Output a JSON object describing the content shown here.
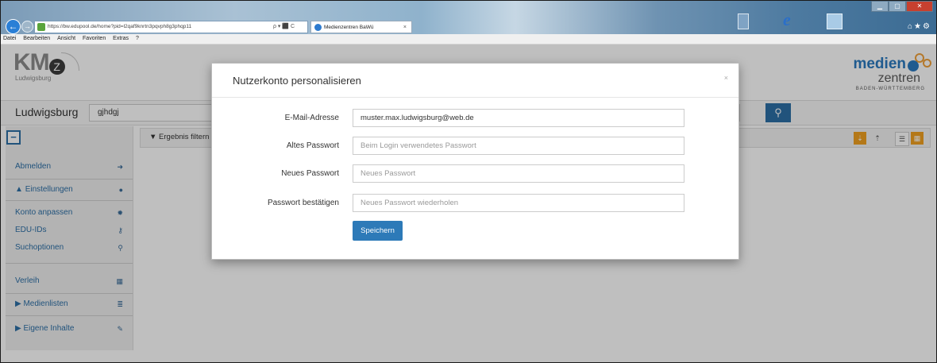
{
  "browser": {
    "url": "https://bw.edupool.de/home?pid=l2qaf9knrtn3pqvph8g3phqp11",
    "address_controls": "ρ ▾ ⬛ C",
    "tab_title": "Medienzentren BaWü",
    "tab_close": "×",
    "menu": [
      "Datei",
      "Bearbeiten",
      "Ansicht",
      "Favoriten",
      "Extras",
      "?"
    ]
  },
  "header": {
    "left_logo": {
      "mark": "KM",
      "z": "Z",
      "city": "Ludwigsburg"
    },
    "right_logo": {
      "word1": "medien",
      "word2": "zentren",
      "word3": "BADEN-WÜRTTEMBERG"
    }
  },
  "search": {
    "city": "Ludwigsburg",
    "query": "gjhdgj",
    "button_icon": "search-icon"
  },
  "sidebar": {
    "toggle_icon": "minus-icon",
    "items": [
      {
        "label": "Abmelden",
        "icon": "sign-out-icon",
        "glyph": "➜"
      },
      {
        "label": "Einstellungen",
        "icon": "user-icon",
        "glyph": "●",
        "expanded": true
      },
      {
        "label": "Konto anpassen",
        "icon": "gear-icon",
        "glyph": "✹"
      },
      {
        "label": "EDU-IDs",
        "icon": "key-icon",
        "glyph": "⚷"
      },
      {
        "label": "Suchoptionen",
        "icon": "search-icon",
        "glyph": "⚲"
      },
      {
        "label": "Verleih",
        "icon": "calendar-icon",
        "glyph": "▦"
      },
      {
        "label": "Medienlisten",
        "icon": "list-icon",
        "glyph": "≣"
      },
      {
        "label": "Eigene Inhalte",
        "icon": "edit-icon",
        "glyph": "✎"
      }
    ]
  },
  "results": {
    "filter_label": "Ergebnis filtern"
  },
  "modal": {
    "title": "Nutzerkonto personalisieren",
    "close": "×",
    "fields": [
      {
        "label": "E-Mail-Adresse",
        "value": "muster.max.ludwigsburg@web.de",
        "placeholder": ""
      },
      {
        "label": "Altes Passwort",
        "value": "",
        "placeholder": "Beim Login verwendetes Passwort"
      },
      {
        "label": "Neues Passwort",
        "value": "",
        "placeholder": "Neues Passwort"
      },
      {
        "label": "Passwort bestätigen",
        "value": "",
        "placeholder": "Neues Passwort wiederholen"
      }
    ],
    "save_label": "Speichern"
  },
  "colors": {
    "accent": "#2d6fa6",
    "button": "#2d7ab8",
    "view_toggle_active": "#f0a020"
  }
}
